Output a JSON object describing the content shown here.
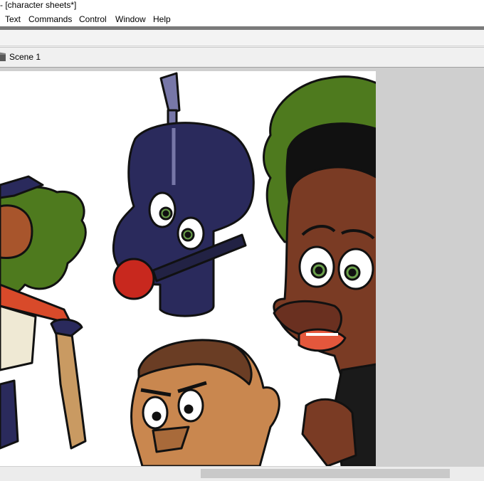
{
  "window": {
    "title": "- [character sheets*]"
  },
  "menu": {
    "items": [
      "Text",
      "Commands",
      "Control",
      "Window",
      "Help"
    ]
  },
  "timeline": {
    "scene_label": "Scene 1"
  },
  "colors": {
    "menubar": "#ffffff",
    "stage_background": "#cfcfcf",
    "canvas": "#ffffff",
    "hair_green": "#4e7a1e",
    "skin_dark": "#7a3b24",
    "skin_light": "#c9874f",
    "mask_navy": "#2a2a5c",
    "nose_red": "#c8281e"
  },
  "icons": {
    "scene": "scene-clapper-icon"
  }
}
